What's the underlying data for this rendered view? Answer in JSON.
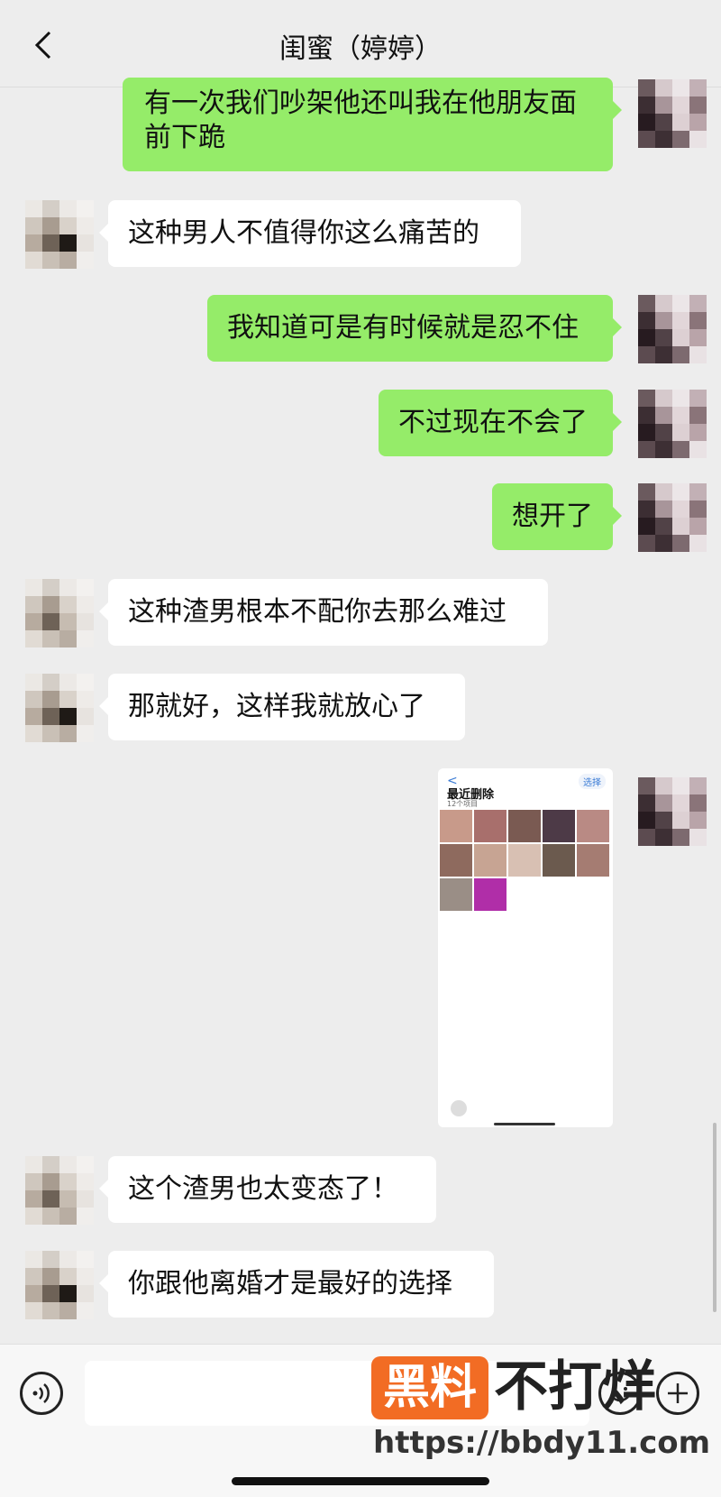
{
  "header": {
    "title": "闺蜜（婷婷）",
    "back_icon": "chevron-left-icon"
  },
  "messages": [
    {
      "side": "right",
      "text_lines": [
        "有一次我们吵架他还叫我在他朋友面",
        "前下跪"
      ]
    },
    {
      "side": "left",
      "text": "这种男人不值得你这么痛苦的"
    },
    {
      "side": "right",
      "text": "我知道可是有时候就是忍不住"
    },
    {
      "side": "right",
      "text": "不过现在不会了"
    },
    {
      "side": "right",
      "text": "想开了"
    },
    {
      "side": "left",
      "text": "这种渣男根本不配你去那么难过"
    },
    {
      "side": "left",
      "text": "那就好，这样我就放心了"
    },
    {
      "side": "right",
      "type": "image",
      "image": {
        "back": "<",
        "select_label": "选择",
        "title": "最近删除",
        "subtitle": "12个项目"
      }
    },
    {
      "side": "left",
      "text": "这个渣男也太变态了！"
    },
    {
      "side": "left",
      "text": "你跟他离婚才是最好的选择"
    }
  ],
  "input_bar": {
    "voice_icon": "voice-icon",
    "emoji_icon": "emoji-icon",
    "plus_icon": "plus-icon"
  },
  "watermark": {
    "logo": "黑料",
    "text": "不打烊",
    "url": "https://bbdy11.com"
  },
  "colors": {
    "bubble_green": "#95ec69",
    "bubble_white": "#ffffff",
    "background": "#ededed",
    "watermark_orange": "#f26c24"
  }
}
